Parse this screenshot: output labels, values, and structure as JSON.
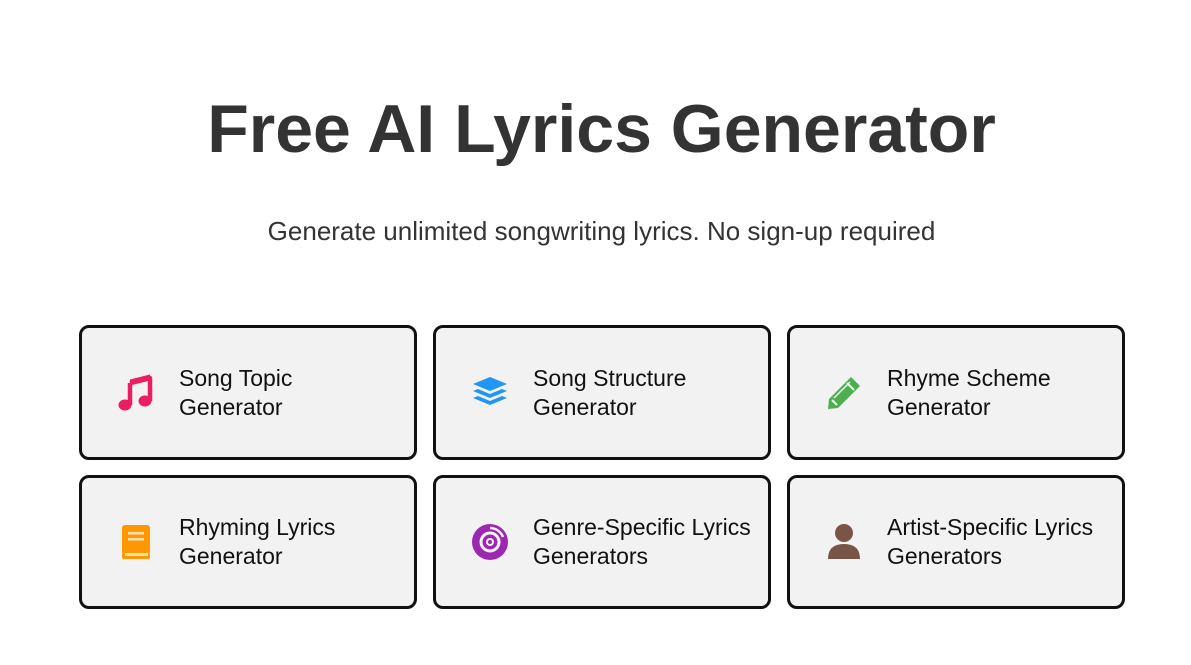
{
  "header": {
    "title": "Free AI Lyrics Generator",
    "subtitle": "Generate unlimited songwriting lyrics. No sign-up required"
  },
  "tools": [
    {
      "line1": "Song Topic",
      "line2": "Generator",
      "icon": "music-note-icon",
      "color": "#e91e63"
    },
    {
      "line1": "Song Structure",
      "line2": "Generator",
      "icon": "layers-icon",
      "color": "#2196f3"
    },
    {
      "line1": "Rhyme Scheme",
      "line2": "Generator",
      "icon": "pencil-icon",
      "color": "#4caf50"
    },
    {
      "line1": "Rhyming Lyrics",
      "line2": "Generator",
      "icon": "book-icon",
      "color": "#ff9800"
    },
    {
      "line1": "Genre-Specific Lyrics",
      "line2": "Generators",
      "icon": "record-disc-icon",
      "color": "#9c27b0"
    },
    {
      "line1": "Artist-Specific Lyrics",
      "line2": "Generators",
      "icon": "user-icon",
      "color": "#795548"
    }
  ]
}
